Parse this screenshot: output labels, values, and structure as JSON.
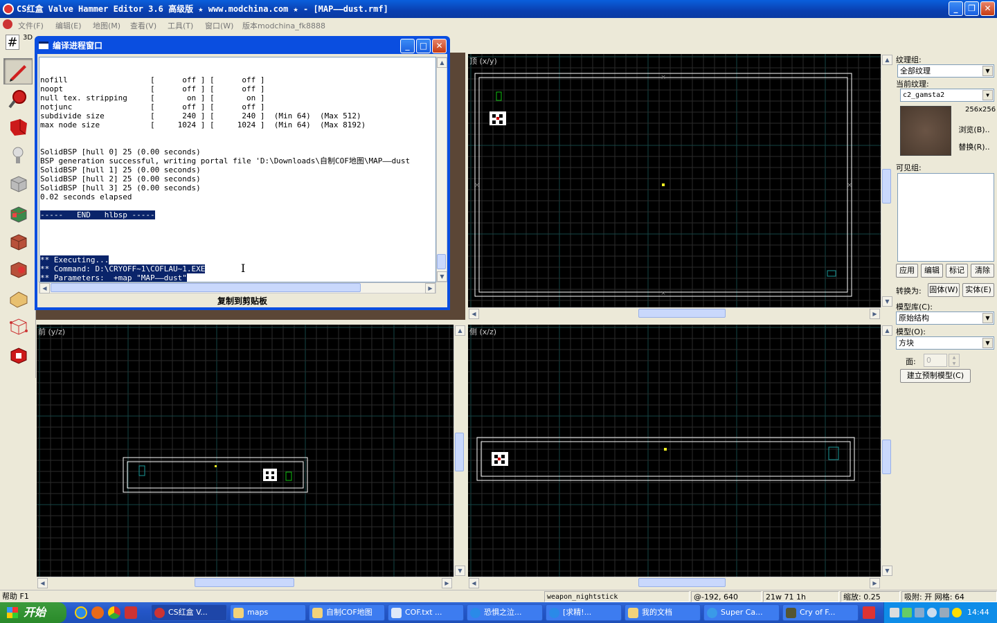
{
  "window": {
    "title": "CS红盒 Valve Hammer Editor 3.6 高级版 ★ www.modchina.com ★ - [MAP——dust.rmf]",
    "min": "_",
    "restore": "❐",
    "close": "✕"
  },
  "menu": {
    "items": [
      "文件(F)",
      "编辑(E)",
      "地图(M)",
      "查看(V)",
      "工具(T)",
      "窗口(W)",
      "版本modchina_fk8888"
    ]
  },
  "toolbar": {
    "grid_label": "#",
    "view3d_label": "3D"
  },
  "compile_window": {
    "title": "编译进程窗口",
    "lines": [
      "nofill                  [      off ] [      off ]",
      "noopt                   [      off ] [      off ]",
      "null tex. stripping     [       on ] [       on ]",
      "notjunc                 [      off ] [      off ]",
      "subdivide size          [      240 ] [      240 ]  (Min 64)  (Max 512)",
      "max node size           [     1024 ] [     1024 ]  (Min 64)  (Max 8192)",
      "",
      "",
      "SolidBSP [hull 0] 25 (0.00 seconds)",
      "BSP generation successful, writing portal file 'D:\\Downloads\\自制COF地图\\MAP——dust",
      "SolidBSP [hull 1] 25 (0.00 seconds)",
      "SolidBSP [hull 2] 25 (0.00 seconds)",
      "SolidBSP [hull 3] 25 (0.00 seconds)",
      "0.02 seconds elapsed"
    ],
    "end_line": "-----   END   hlbsp -----",
    "exec_lines": [
      "** Executing...",
      "** Command: D:\\CRYOFF~1\\COFLAU~1.EXE",
      "** Parameters:  +map \"MAP——dust\""
    ],
    "copy_button": "复制到剪贴板"
  },
  "views": {
    "top_label": "顶 (x/y)",
    "front_label": "前 (y/z)",
    "side_label": "侧 (x/z)"
  },
  "right_panel": {
    "texture_group_label": "纹理组:",
    "texture_group_value": "全部纹理",
    "current_texture_label": "当前纹理:",
    "current_texture_value": "c2_gamsta2",
    "texture_size": "256x256",
    "browse_button": "浏览(B)..",
    "replace_button": "替换(R)..",
    "visgroup_label": "可见组:",
    "apply_button": "应用",
    "edit_button": "编辑",
    "mark_button": "标记",
    "purge_button": "清除",
    "convert_label": "转换为:",
    "to_world_button": "固体(W)",
    "to_entity_button": "实体(E)",
    "prefab_lib_label": "模型库(C):",
    "prefab_lib_value": "原始结构",
    "prefab_label": "模型(O):",
    "prefab_value": "方块",
    "faces_label": "面:",
    "faces_value": "0",
    "create_prefab_button": "建立预制模型(C)"
  },
  "status": {
    "help": "帮助 F1",
    "entity": "weapon_nightstick",
    "coords": "@-192, 640",
    "size": "21w 71 1h",
    "zoom": "缩放: 0.25",
    "snap": "吸附: 开 网格: 64"
  },
  "taskbar": {
    "start": "开始",
    "tasks": [
      "CS红盒 V...",
      "maps",
      "自制COF地图",
      "COF.txt ...",
      "恐惧之泣...",
      "[求精!...",
      "我的文档",
      "Super Ca...",
      "Cry of F..."
    ],
    "clock": "14:44"
  },
  "colors": {
    "grid_minor": "#2b2b2b",
    "grid_major": "#144646",
    "brush": "#ffffff",
    "entity_green": "#10c010",
    "entity_cyan": "#1a9a9a",
    "selection": "#0a246a"
  }
}
